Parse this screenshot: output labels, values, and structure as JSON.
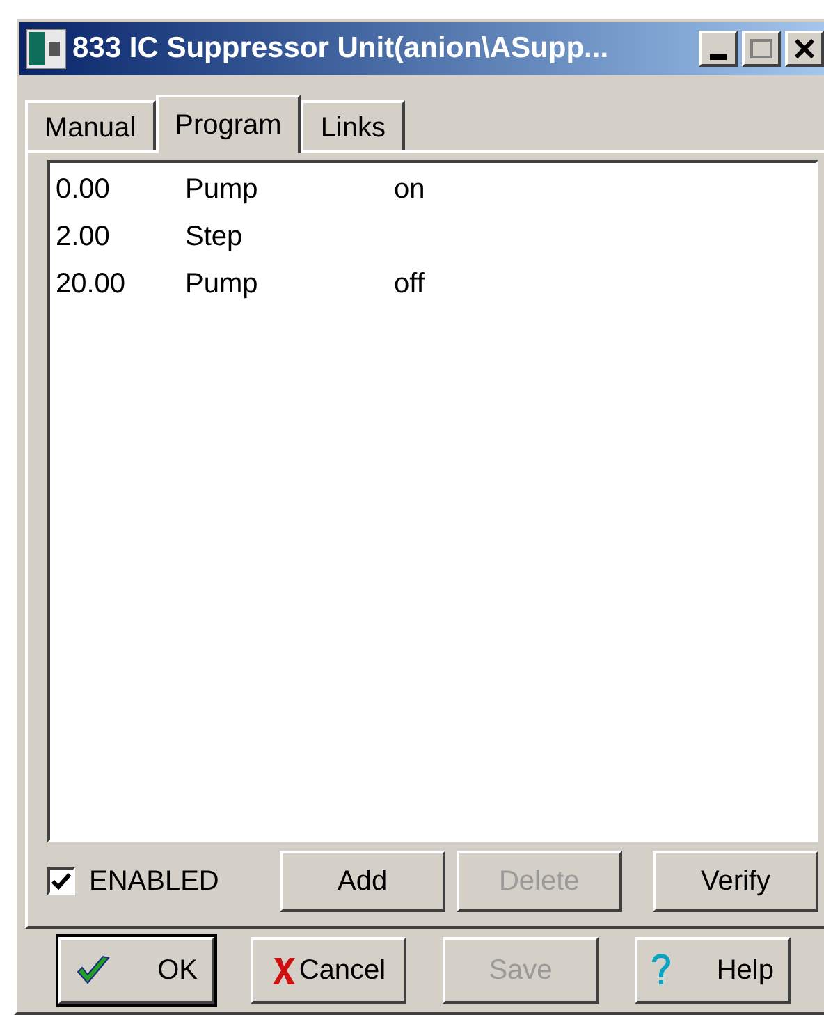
{
  "window": {
    "title": "833 IC Suppressor Unit(anion\\ASupp..."
  },
  "tabs": [
    {
      "label": "Manual",
      "selected": false
    },
    {
      "label": "Program",
      "selected": true
    },
    {
      "label": "Links",
      "selected": false
    }
  ],
  "program": {
    "rows": [
      {
        "time": "0.00",
        "command": "Pump",
        "value": "on"
      },
      {
        "time": "2.00",
        "command": "Step"
      },
      {
        "time": "20.00",
        "command": "Pump",
        "value": "off"
      }
    ]
  },
  "enabled": {
    "label": "ENABLED",
    "checked": true
  },
  "list_buttons": [
    {
      "label": "Add",
      "disabled": false
    },
    {
      "label": "Delete",
      "disabled": true
    },
    {
      "label": "Verify",
      "disabled": false
    }
  ],
  "dialog_buttons": [
    {
      "kind": "ok",
      "label": "OK",
      "disabled": false
    },
    {
      "kind": "cancel",
      "label": "Cancel",
      "disabled": false
    },
    {
      "kind": "save",
      "label": "Save",
      "disabled": true
    },
    {
      "kind": "help",
      "label": "Help",
      "disabled": false
    }
  ]
}
